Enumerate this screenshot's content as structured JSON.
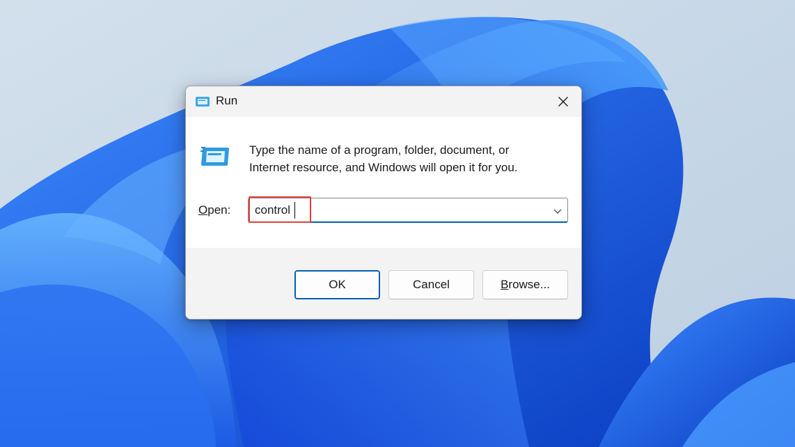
{
  "dialog": {
    "title": "Run",
    "description_line1": "Type the name of a program, folder, document, or",
    "description_line2": "Internet resource, and Windows will open it for you.",
    "open_label_accel": "O",
    "open_label_rest": "pen:",
    "open_value": "control",
    "buttons": {
      "ok": "OK",
      "cancel": "Cancel",
      "browse_accel": "B",
      "browse_rest": "rowse..."
    }
  },
  "icons": {
    "title": "run-icon",
    "main": "run-icon",
    "close": "close-icon",
    "dropdown": "chevron-down-icon"
  },
  "colors": {
    "accent": "#005fb8",
    "highlight": "#e0403a",
    "wallpaper_blue": "#1a5ce0",
    "wallpaper_bg": "#c9d8e6"
  }
}
